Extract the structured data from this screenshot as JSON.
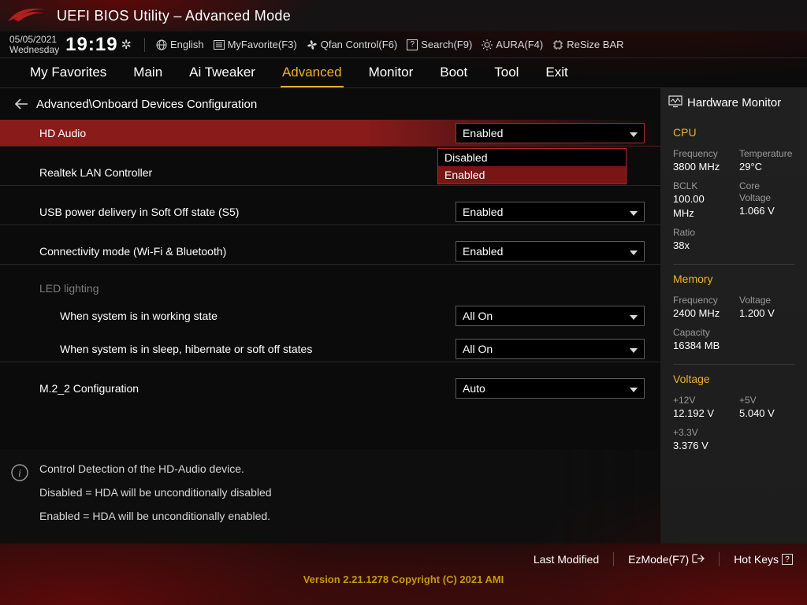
{
  "header": {
    "title": "UEFI BIOS Utility – Advanced Mode",
    "date": "05/05/2021",
    "day": "Wednesday",
    "clock": "19:19"
  },
  "quick": {
    "language": "English",
    "myfav": "MyFavorite(F3)",
    "qfan": "Qfan Control(F6)",
    "search": "Search(F9)",
    "aura": "AURA(F4)",
    "resize": "ReSize BAR"
  },
  "tabs": [
    "My Favorites",
    "Main",
    "Ai Tweaker",
    "Advanced",
    "Monitor",
    "Boot",
    "Tool",
    "Exit"
  ],
  "active_tab": "Advanced",
  "breadcrumb": "Advanced\\Onboard Devices Configuration",
  "settings": {
    "hd_audio": {
      "label": "HD Audio",
      "value": "Enabled",
      "options": [
        "Disabled",
        "Enabled"
      ],
      "selected": "Enabled"
    },
    "realtek_lan": {
      "label": "Realtek LAN Controller",
      "value": ""
    },
    "usb_s5": {
      "label": "USB power delivery in Soft Off state (S5)",
      "value": "Enabled"
    },
    "conn_mode": {
      "label": "Connectivity mode (Wi-Fi & Bluetooth)",
      "value": "Enabled"
    },
    "led_section": "LED lighting",
    "led_working": {
      "label": "When system is in working state",
      "value": "All On"
    },
    "led_sleep": {
      "label": "When system is in sleep, hibernate or soft off states",
      "value": "All On"
    },
    "m2_2": {
      "label": "M.2_2 Configuration",
      "value": "Auto"
    }
  },
  "help": {
    "l1": "Control Detection of the HD-Audio device.",
    "l2": "Disabled = HDA will be unconditionally disabled",
    "l3": "Enabled = HDA will be unconditionally enabled."
  },
  "hw": {
    "title": "Hardware Monitor",
    "cpu": {
      "title": "CPU",
      "freq_lbl": "Frequency",
      "freq": "3800 MHz",
      "temp_lbl": "Temperature",
      "temp": "29°C",
      "bclk_lbl": "BCLK",
      "bclk": "100.00 MHz",
      "cv_lbl": "Core Voltage",
      "cv": "1.066 V",
      "ratio_lbl": "Ratio",
      "ratio": "38x"
    },
    "mem": {
      "title": "Memory",
      "freq_lbl": "Frequency",
      "freq": "2400 MHz",
      "volt_lbl": "Voltage",
      "volt": "1.200 V",
      "cap_lbl": "Capacity",
      "cap": "16384 MB"
    },
    "volt": {
      "title": "Voltage",
      "v12_lbl": "+12V",
      "v12": "12.192 V",
      "v5_lbl": "+5V",
      "v5": "5.040 V",
      "v33_lbl": "+3.3V",
      "v33": "3.376 V"
    }
  },
  "footer": {
    "lastmod": "Last Modified",
    "ezmode": "EzMode(F7)",
    "hotkeys": "Hot Keys"
  },
  "version": "Version 2.21.1278 Copyright (C) 2021 AMI"
}
